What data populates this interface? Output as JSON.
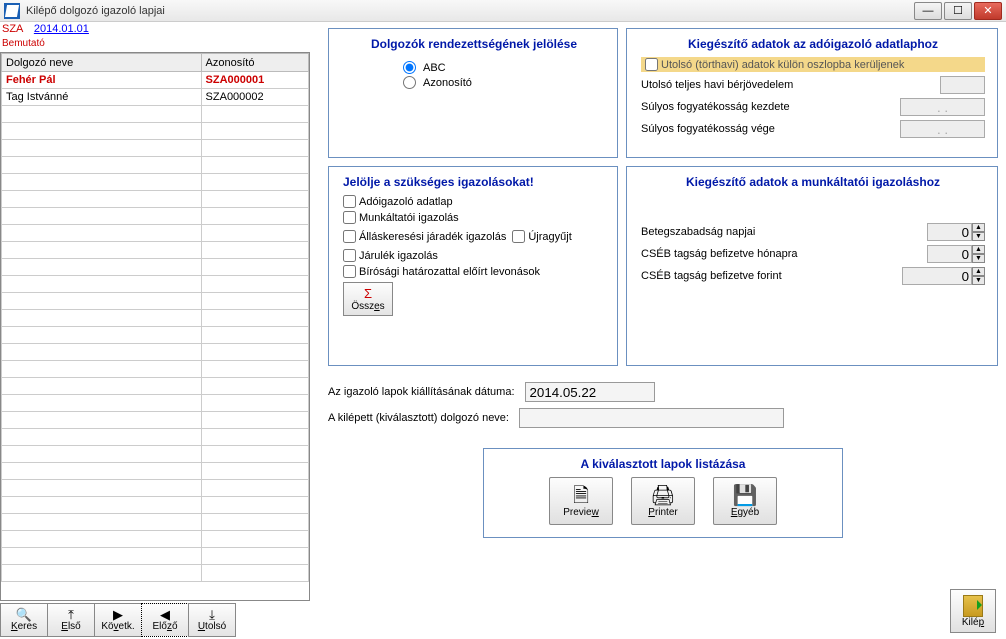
{
  "window": {
    "title": "Kilépő dolgozó igazoló lapjai"
  },
  "top": {
    "sza": "SZA",
    "date": "2014.01.01",
    "bemutato": "Bemutató"
  },
  "grid": {
    "col_name": "Dolgozó neve",
    "col_id": "Azonosító",
    "rows": [
      {
        "name": "Fehér Pál",
        "id": "SZA000001",
        "selected": true
      },
      {
        "name": "Tag Istvánné",
        "id": "SZA000002",
        "selected": false
      }
    ],
    "empty_rows": 28
  },
  "nav": {
    "keres": "Keres",
    "elso": "Első",
    "kovetk": "Követk.",
    "elozo": "Előző",
    "utolso": "Utolsó"
  },
  "panels": {
    "sort_title": "Dolgozók rendezettségének jelölése",
    "sort_abc": "ABC",
    "sort_azon": "Azonosító",
    "adat_title": "Kiegészítő adatok az adóigazoló adatlaphoz",
    "adat_yellow": "Utolsó (törthavi) adatok külön oszlopba kerüljenek",
    "adat_f1": "Utolsó teljes havi bérjövedelem",
    "adat_f2": "Súlyos fogyatékosság kezdete",
    "adat_f3": "Súlyos fogyatékosság vége",
    "adat_date_placeholder": ". .",
    "szuks_title": "Jelölje a szükséges igazolásokat!",
    "chk1": "Adóigazoló adatlap",
    "chk2": "Munkáltatói igazolás",
    "chk3": "Álláskeresési járadék igazolás",
    "chk3b": "Újragyűjt",
    "chk4": "Járulék igazolás",
    "chk5": "Bírósági határozattal előírt levonások",
    "osszes": "Összes",
    "munk_title": "Kiegészítő adatok a munkáltatói igazoláshoz",
    "munk_f1": "Betegszabadság napjai",
    "munk_f2": "CSÉB tagság befizetve hónapra",
    "munk_f3": "CSÉB tagság befizetve forint",
    "munk_val": "0"
  },
  "mid": {
    "kiall_label": "Az igazoló lapok kiállításának dátuma:",
    "kiall_date": "2014.05.22",
    "kilep_label": "A kilépett (kiválasztott) dolgozó neve:",
    "kilep_name": ""
  },
  "lista": {
    "title": "A kiválasztott lapok listázása",
    "preview": "Preview",
    "printer": "Printer",
    "egyeb": "Egyéb"
  },
  "kilep_btn": "Kilép"
}
